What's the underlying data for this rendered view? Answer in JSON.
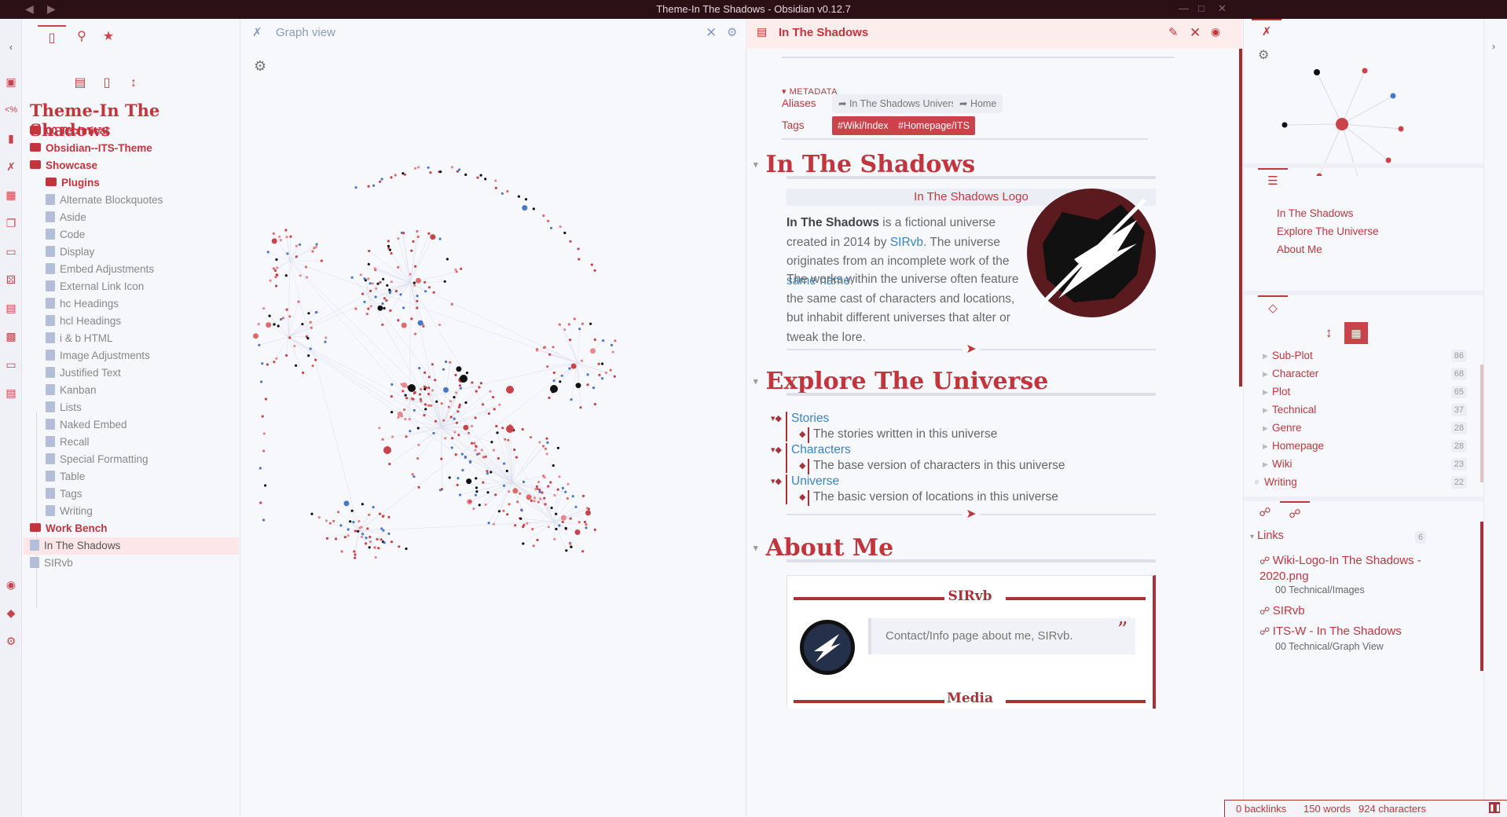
{
  "window": {
    "title": "Theme-In The Shadows - Obsidian v0.12.7"
  },
  "sidebar": {
    "vault_name": "Theme-In The Shadows",
    "tree": [
      {
        "label": "00 Technical",
        "type": "folder",
        "level": 0
      },
      {
        "label": "Obsidian--ITS-Theme",
        "type": "folder",
        "level": 0
      },
      {
        "label": "Showcase",
        "type": "folder",
        "level": 0
      },
      {
        "label": "Plugins",
        "type": "folder",
        "level": 1
      },
      {
        "label": "Alternate Blockquotes",
        "type": "file",
        "level": 1
      },
      {
        "label": "Aside",
        "type": "file",
        "level": 1
      },
      {
        "label": "Code",
        "type": "file",
        "level": 1
      },
      {
        "label": "Display",
        "type": "file",
        "level": 1
      },
      {
        "label": "Embed Adjustments",
        "type": "file",
        "level": 1
      },
      {
        "label": "External Link Icon",
        "type": "file",
        "level": 1
      },
      {
        "label": "hc Headings",
        "type": "file",
        "level": 1
      },
      {
        "label": "hcl Headings",
        "type": "file",
        "level": 1
      },
      {
        "label": "i & b HTML",
        "type": "file",
        "level": 1
      },
      {
        "label": "Image Adjustments",
        "type": "file",
        "level": 1
      },
      {
        "label": "Justified Text",
        "type": "file",
        "level": 1
      },
      {
        "label": "Kanban",
        "type": "file",
        "level": 1
      },
      {
        "label": "Lists",
        "type": "file",
        "level": 1
      },
      {
        "label": "Naked Embed",
        "type": "file",
        "level": 1
      },
      {
        "label": "Recall",
        "type": "file",
        "level": 1
      },
      {
        "label": "Special Formatting",
        "type": "file",
        "level": 1
      },
      {
        "label": "Table",
        "type": "file",
        "level": 1
      },
      {
        "label": "Tags",
        "type": "file",
        "level": 1
      },
      {
        "label": "Writing",
        "type": "file",
        "level": 1
      },
      {
        "label": "Work Bench",
        "type": "folder",
        "level": 0
      },
      {
        "label": "In The Shadows",
        "type": "file",
        "level": 0,
        "active": true
      },
      {
        "label": "SIRvb",
        "type": "file",
        "level": 0
      }
    ]
  },
  "graph_pane": {
    "title": "Graph view"
  },
  "note_pane": {
    "title": "In The Shadows",
    "metadata_heading": "METADATA",
    "aliases_label": "Aliases",
    "aliases": [
      "In The Shadows Universe",
      "Home"
    ],
    "tags_label": "Tags",
    "tags": [
      "#Wiki/Index",
      "#Homepage/ITS"
    ],
    "h1_intro": "In The Shadows",
    "logo_caption": "In The Shadows Logo",
    "intro": {
      "bold": "In The Shadows",
      "t1": " is a fictional universe created in 2014 by ",
      "link1": "SIRvb",
      "t2": ". The universe originates from an incomplete work of the ",
      "link2": "same name",
      "t3": "."
    },
    "para2": "The works within the universe often feature the same cast of characters and locations, but inhabit different universes that alter or tweak the lore.",
    "h1_explore": "Explore The Universe",
    "explore_list": [
      {
        "link": "Stories",
        "desc": "The stories written in this universe"
      },
      {
        "link": "Characters",
        "desc": "The base version of characters in this universe"
      },
      {
        "link": "Universe",
        "desc": "The basic version of locations in this universe"
      }
    ],
    "h1_about": "About Me",
    "card": {
      "title": "SIRvb",
      "quote": "Contact/Info page about me, SIRvb.",
      "quote_mark": "”",
      "subtitle": "Media"
    }
  },
  "right_pane": {
    "outline": [
      "In The Shadows",
      "Explore The Universe",
      "About Me"
    ],
    "tags": [
      {
        "name": "Sub-Plot",
        "count": "86"
      },
      {
        "name": "Character",
        "count": "68"
      },
      {
        "name": "Plot",
        "count": "65"
      },
      {
        "name": "Technical",
        "count": "37"
      },
      {
        "name": "Genre",
        "count": "28"
      },
      {
        "name": "Homepage",
        "count": "28"
      },
      {
        "name": "Wiki",
        "count": "23"
      },
      {
        "name": "Writing",
        "count": "22"
      }
    ],
    "links_heading": "Links",
    "links_count": "6",
    "links": [
      {
        "name": "Wiki-Logo-In The Shadows - 2020.png",
        "path": "00 Technical/Images"
      },
      {
        "name": "SIRvb",
        "path": ""
      },
      {
        "name": "ITS-W - In The Shadows",
        "path": "00 Technical/Graph View"
      }
    ]
  },
  "statusbar": {
    "backlinks": "0 backlinks",
    "words": "150 words",
    "characters": "924 characters"
  },
  "colors": {
    "accent": "#c2353d",
    "accent_dark": "#a83238",
    "link": "#3a84c4",
    "titlebar": "#2b1016"
  }
}
